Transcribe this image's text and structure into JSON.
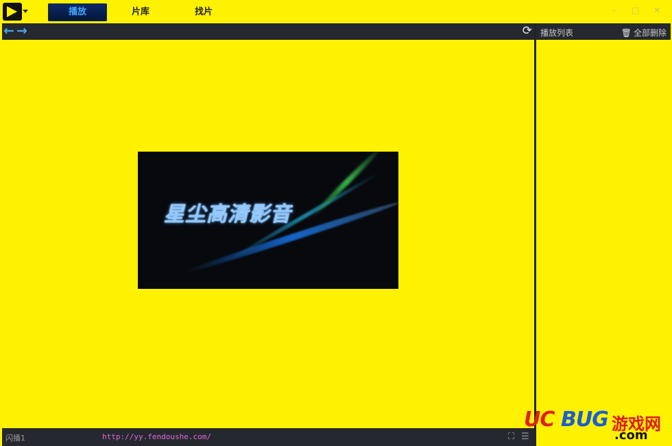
{
  "titlebar": {
    "tabs": [
      {
        "label": "播放",
        "active": true
      },
      {
        "label": "片库",
        "active": false
      },
      {
        "label": "找片",
        "active": false
      }
    ],
    "controls": {
      "minimize": "–",
      "maximize": "□",
      "close": "✕"
    }
  },
  "navbar": {
    "back_icon": "←",
    "forward_icon": "→",
    "refresh_icon": "⟳"
  },
  "playlist": {
    "title": "播放列表",
    "clear_label": "全部删除",
    "clear_icon": "🗑"
  },
  "splash": {
    "title": "星尘高清影音"
  },
  "statusbar": {
    "text": "闪播1",
    "url": "http://yy.fendoushe.com/",
    "fullscreen_icon": "⛶",
    "list_icon": "☰"
  },
  "watermark": {
    "uc": "UC",
    "bug": "BUG",
    "cn": "游戏网",
    "com": ".com"
  },
  "colors": {
    "background": "#fff200",
    "bar": "#25292f",
    "active_tab": "#0d2a66",
    "accent": "#4aa7e6"
  }
}
